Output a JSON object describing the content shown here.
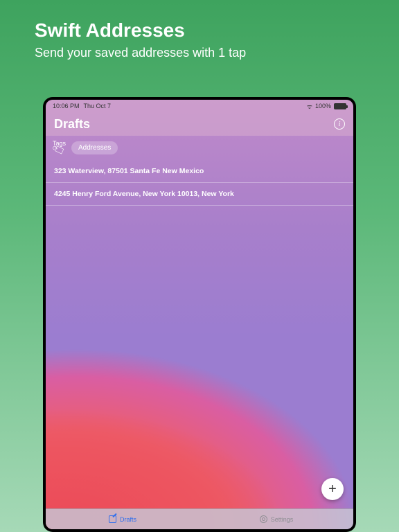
{
  "promo": {
    "title": "Swift Addresses",
    "subtitle": "Send your saved addresses with 1 tap"
  },
  "status": {
    "time": "10:06 PM",
    "date": "Thu Oct 7",
    "battery_pct": "100%"
  },
  "nav": {
    "title": "Drafts"
  },
  "tags": {
    "label": "Tags",
    "chip": "Addresses"
  },
  "rows": [
    "323 Waterview, 87501 Santa Fe New Mexico",
    "4245 Henry Ford Avenue, New York 10013, New York"
  ],
  "fab": "+",
  "tabs": {
    "drafts": "Drafts",
    "settings": "Settings"
  }
}
